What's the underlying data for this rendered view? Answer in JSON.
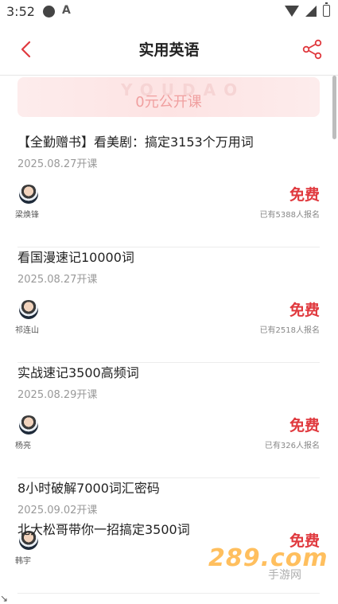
{
  "status_bar": {
    "time": "3:52",
    "a_icon": "A"
  },
  "nav": {
    "title": "实用英语"
  },
  "banner": {
    "watermark": "YOUDAO",
    "text": "0元公开课"
  },
  "courses": [
    {
      "title": "【全勤赠书】看美剧：搞定3153个万用词",
      "date": "2025.08.27开课",
      "teacher": "梁焕锋",
      "price": "免费",
      "signup": "已有5388人报名"
    },
    {
      "title": "看国漫速记10000词",
      "date": "2025.08.27开课",
      "teacher": "祁连山",
      "price": "免费",
      "signup": "已有2518人报名"
    },
    {
      "title": "实战速记3500高频词",
      "date": "2025.08.29开课",
      "teacher": "杨亮",
      "price": "免费",
      "signup": "已有326人报名"
    },
    {
      "title": "8小时破解7000词汇密码",
      "date": "2025.09.02开课",
      "teacher": "韩宇",
      "price": "免费",
      "signup": ""
    }
  ],
  "partial_course": {
    "title": "北大松哥带你一招搞定3500词"
  },
  "watermark": {
    "logo": "289.com",
    "sub": "手游网"
  },
  "colors": {
    "accent": "#e0393e",
    "banner_text": "#f0a0a0"
  }
}
